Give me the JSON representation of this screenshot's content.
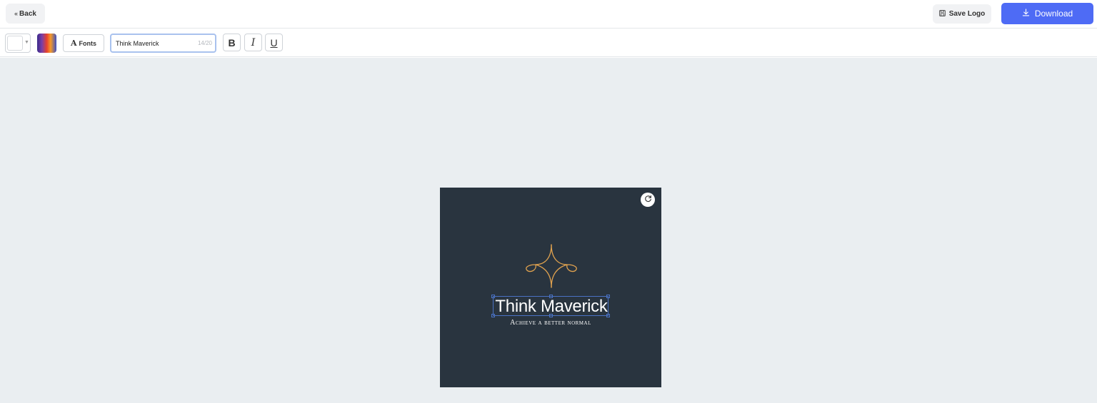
{
  "header": {
    "back_label": "Back",
    "back_icon": "double-chevron-left-icon",
    "save_label": "Save Logo",
    "save_icon": "floppy-disk-icon",
    "download_label": "Download",
    "download_icon": "download-icon",
    "accent_color": "#4e6bf5"
  },
  "toolbar": {
    "text_color": "#ffffff",
    "fonts_label": "Fonts",
    "text_value": "Think Maverick",
    "char_counter": "14/20",
    "bold_label": "B",
    "italic_label": "I",
    "underline_label": "U"
  },
  "canvas": {
    "background_color": "#29343f",
    "symbol_color": "#e0a24f",
    "title": "Think Maverick",
    "tagline": "Achieve a better normal",
    "refresh_icon": "refresh-icon"
  }
}
